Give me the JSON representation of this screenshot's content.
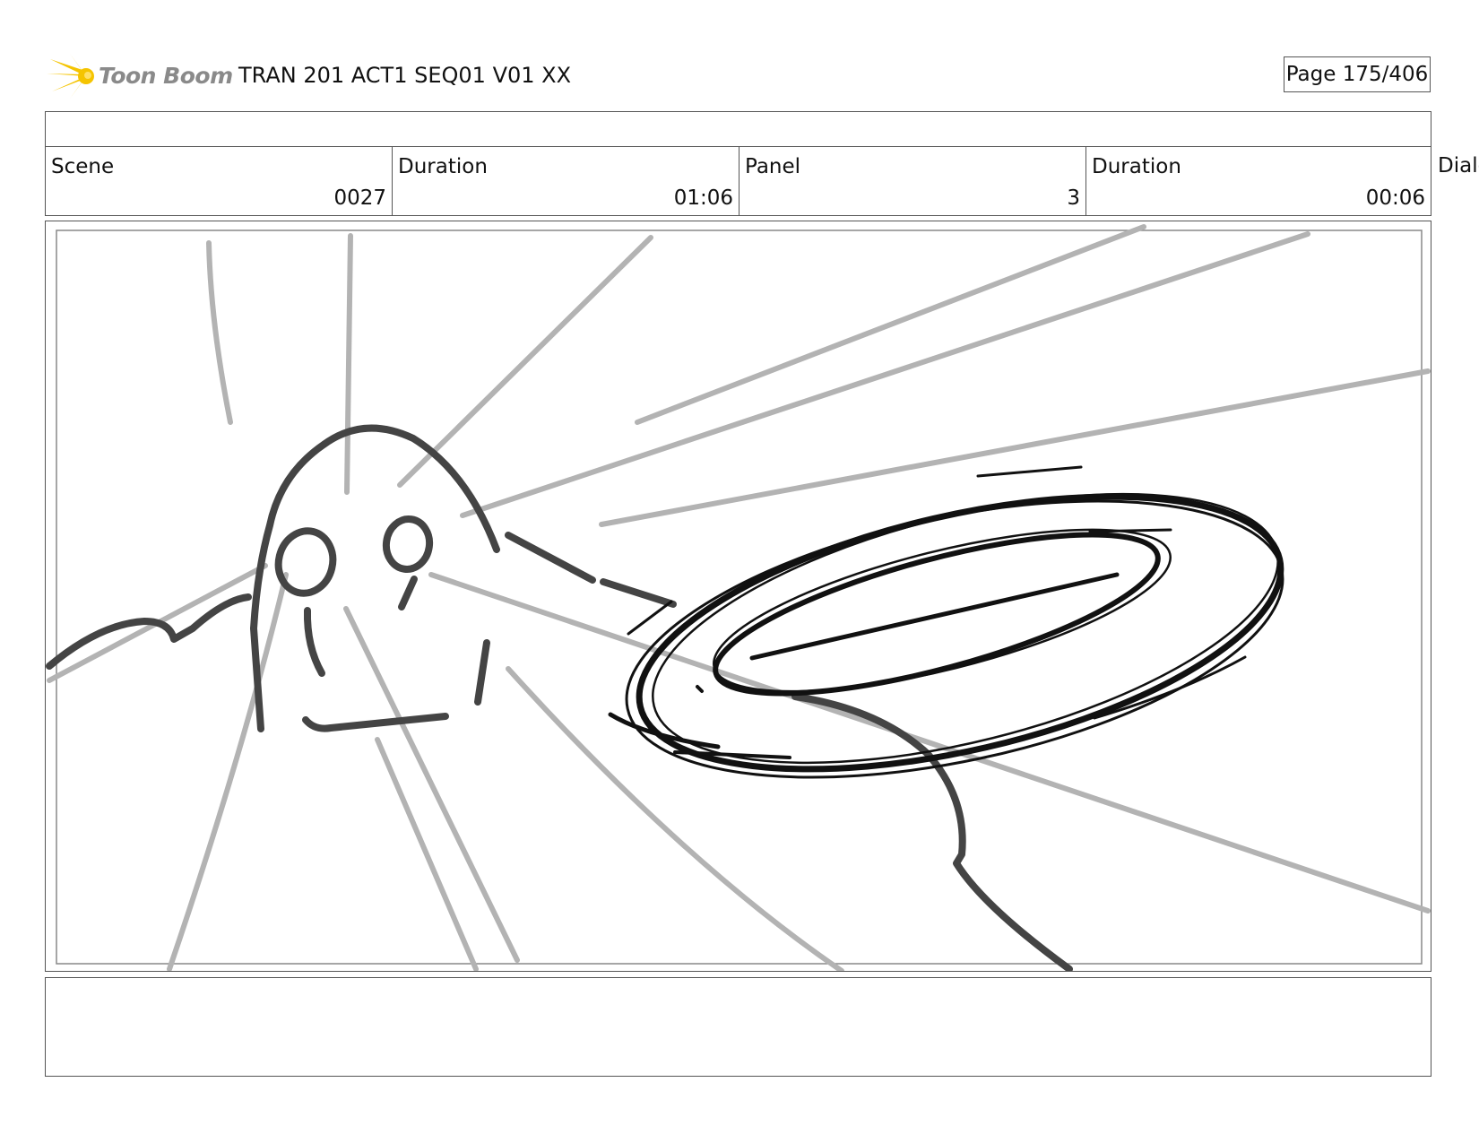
{
  "header": {
    "logo_text": "Toon Boom",
    "title": "TRAN 201 ACT1 SEQ01 V01 XX",
    "page": "Page 175/406"
  },
  "info": {
    "scene_label": "Scene",
    "scene_value": "0027",
    "scene_duration_label": "Duration",
    "scene_duration_value": "01:06",
    "panel_label": "Panel",
    "panel_value": "3",
    "panel_duration_label": "Duration",
    "panel_duration_value": "00:06",
    "dialog_label": "Dialog"
  },
  "colors": {
    "sketch_dark": "#111111",
    "sketch_mid": "#444444",
    "sketch_light": "#b3b3b3",
    "logo_yellow": "#f5c400"
  },
  "icons": {
    "logo": "toon-boom-logo-icon"
  }
}
